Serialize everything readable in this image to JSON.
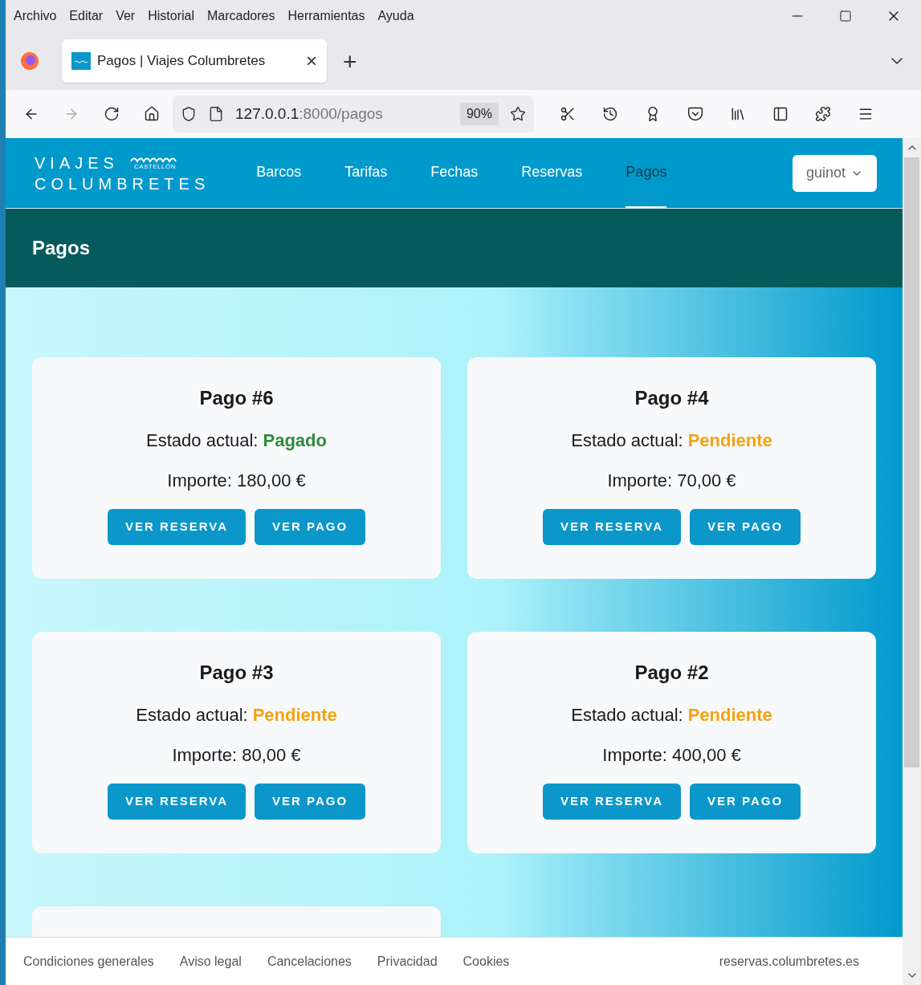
{
  "menu_bar": [
    "Archivo",
    "Editar",
    "Ver",
    "Historial",
    "Marcadores",
    "Herramientas",
    "Ayuda"
  ],
  "tab": {
    "title": "Pagos | Viajes Columbretes",
    "close": "×",
    "new_tab": "+"
  },
  "address_bar": {
    "host": "127.0.0.1",
    "rest": ":8000/pagos",
    "zoom": "90%"
  },
  "site": {
    "logo_top": "VIAJES",
    "logo_sub": "CASTELLÓN",
    "logo_bottom": "COLUMBRETES",
    "nav": [
      {
        "label": "Barcos",
        "selected": false
      },
      {
        "label": "Tarifas",
        "selected": false
      },
      {
        "label": "Fechas",
        "selected": false
      },
      {
        "label": "Reservas",
        "selected": false
      },
      {
        "label": "Pagos",
        "selected": true
      }
    ],
    "user": "guinot"
  },
  "page_title": "Pagos",
  "payments": [
    {
      "title": "Pago #6",
      "status_label": "Estado actual:",
      "status": "Pagado",
      "color": "#2e8b3e",
      "amount": "Importe: 180,00 €",
      "buttons": [
        "VER RESERVA",
        "VER PAGO"
      ]
    },
    {
      "title": "Pago #4",
      "status_label": "Estado actual:",
      "status": "Pendiente",
      "color": "#f5a10f",
      "amount": "Importe: 70,00 €",
      "buttons": [
        "VER RESERVA",
        "VER PAGO"
      ]
    },
    {
      "title": "Pago #3",
      "status_label": "Estado actual:",
      "status": "Pendiente",
      "color": "#f5a10f",
      "amount": "Importe: 80,00 €",
      "buttons": [
        "VER RESERVA",
        "VER PAGO"
      ]
    },
    {
      "title": "Pago #2",
      "status_label": "Estado actual:",
      "status": "Pendiente",
      "color": "#f5a10f",
      "amount": "Importe: 400,00 €",
      "buttons": [
        "VER RESERVA",
        "VER PAGO"
      ]
    }
  ],
  "footer": {
    "links": [
      "Condiciones generales",
      "Aviso legal",
      "Cancelaciones",
      "Privacidad",
      "Cookies"
    ],
    "domain": "reservas.columbretes.es"
  }
}
